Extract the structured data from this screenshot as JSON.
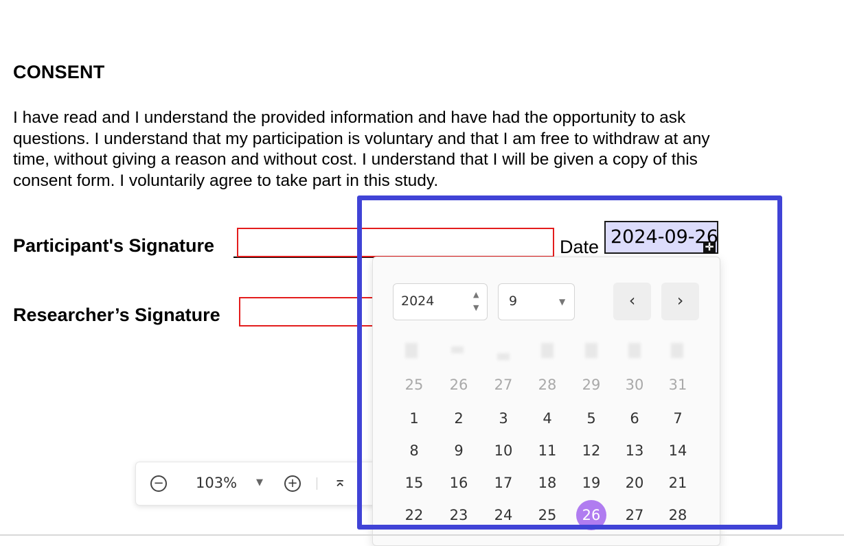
{
  "document": {
    "title": "CONSENT",
    "paragraph": "I have read and I understand the provided information and have had the opportunity to ask questions. I understand that my participation is voluntary and that I am free to withdraw at any time, without giving a reason and without cost. I understand that I will be given a copy of this consent form. I voluntarily agree to take part in this study.",
    "participant_label": "Participant's Signature",
    "researcher_label": "Researcher’s Signature",
    "date_label": "Date",
    "date_value": "2024-09-26"
  },
  "zoom_toolbar": {
    "zoom_out_icon": "minus-circle-icon",
    "zoom_value": "103%",
    "zoom_in_icon": "plus-circle-icon",
    "scroll_top_icon": "scroll-to-top-icon"
  },
  "date_picker": {
    "year": "2024",
    "month": "9",
    "prev_icon": "chevron-left-icon",
    "next_icon": "chevron-right-icon",
    "weeks": [
      [
        "25",
        "26",
        "27",
        "28",
        "29",
        "30",
        "31"
      ],
      [
        "1",
        "2",
        "3",
        "4",
        "5",
        "6",
        "7"
      ],
      [
        "8",
        "9",
        "10",
        "11",
        "12",
        "13",
        "14"
      ],
      [
        "15",
        "16",
        "17",
        "18",
        "19",
        "20",
        "21"
      ],
      [
        "22",
        "23",
        "24",
        "25",
        "26",
        "27",
        "28"
      ]
    ],
    "selected_day": "26"
  },
  "colors": {
    "signature_border": "#e31c1c",
    "highlight_border": "#4043d6",
    "selected_day_bg": "#b07cf0",
    "date_field_bg": "#dcdcfb"
  }
}
